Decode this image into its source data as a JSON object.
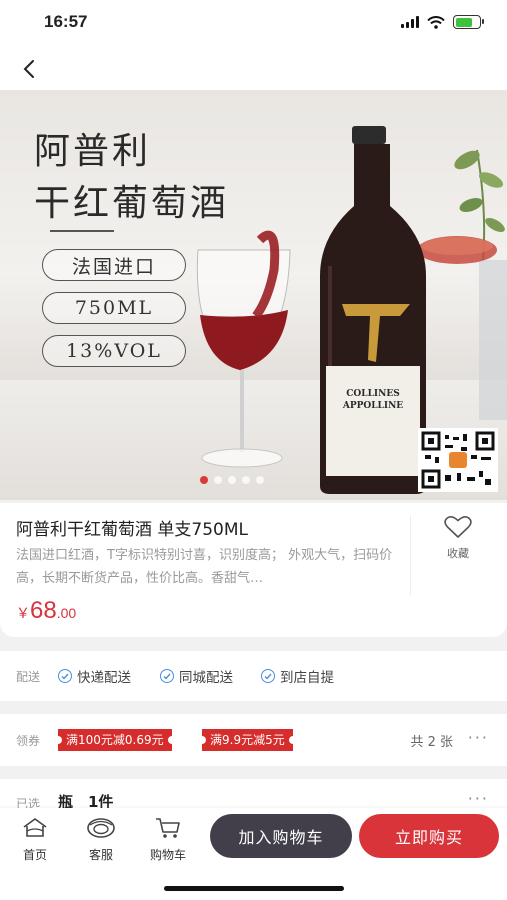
{
  "status": {
    "time": "16:57"
  },
  "hero": {
    "title_line1": "阿普利",
    "title_line2": "干红葡萄酒",
    "pills": [
      "法国进口",
      "750ML",
      "13%VOL"
    ],
    "bottle_label_line1": "COLLINES",
    "bottle_label_line2": "APPOLLINE",
    "slide_count": 5,
    "active_slide": 1
  },
  "product": {
    "title": "阿普利干红葡萄酒 单支750ML",
    "description": "法国进口红酒，T字标识特别讨喜，识别度高； 外观大气，扫码价高，长期不断货产品，性价比高。香甜气…",
    "price_currency": "￥",
    "price_integer": "68",
    "price_decimal": ".00",
    "favorite_label": "收藏"
  },
  "delivery": {
    "label": "配送",
    "options": [
      "快递配送",
      "同城配送",
      "到店自提"
    ]
  },
  "coupons": {
    "label": "领券",
    "items": [
      "满100元减0.69元",
      "满9.9元减5元"
    ],
    "count_text": "共 2 张",
    "more": "···"
  },
  "selected": {
    "label": "已选",
    "value": "瓶　1件",
    "more": "···"
  },
  "bottom": {
    "home_label": "首页",
    "service_label": "客服",
    "cart_label": "购物车",
    "add_to_cart": "加入购物车",
    "buy_now": "立即购买"
  },
  "colors": {
    "accent_red": "#d8343a",
    "dark_button": "#423f4a",
    "check_blue": "#4a8fe0"
  }
}
